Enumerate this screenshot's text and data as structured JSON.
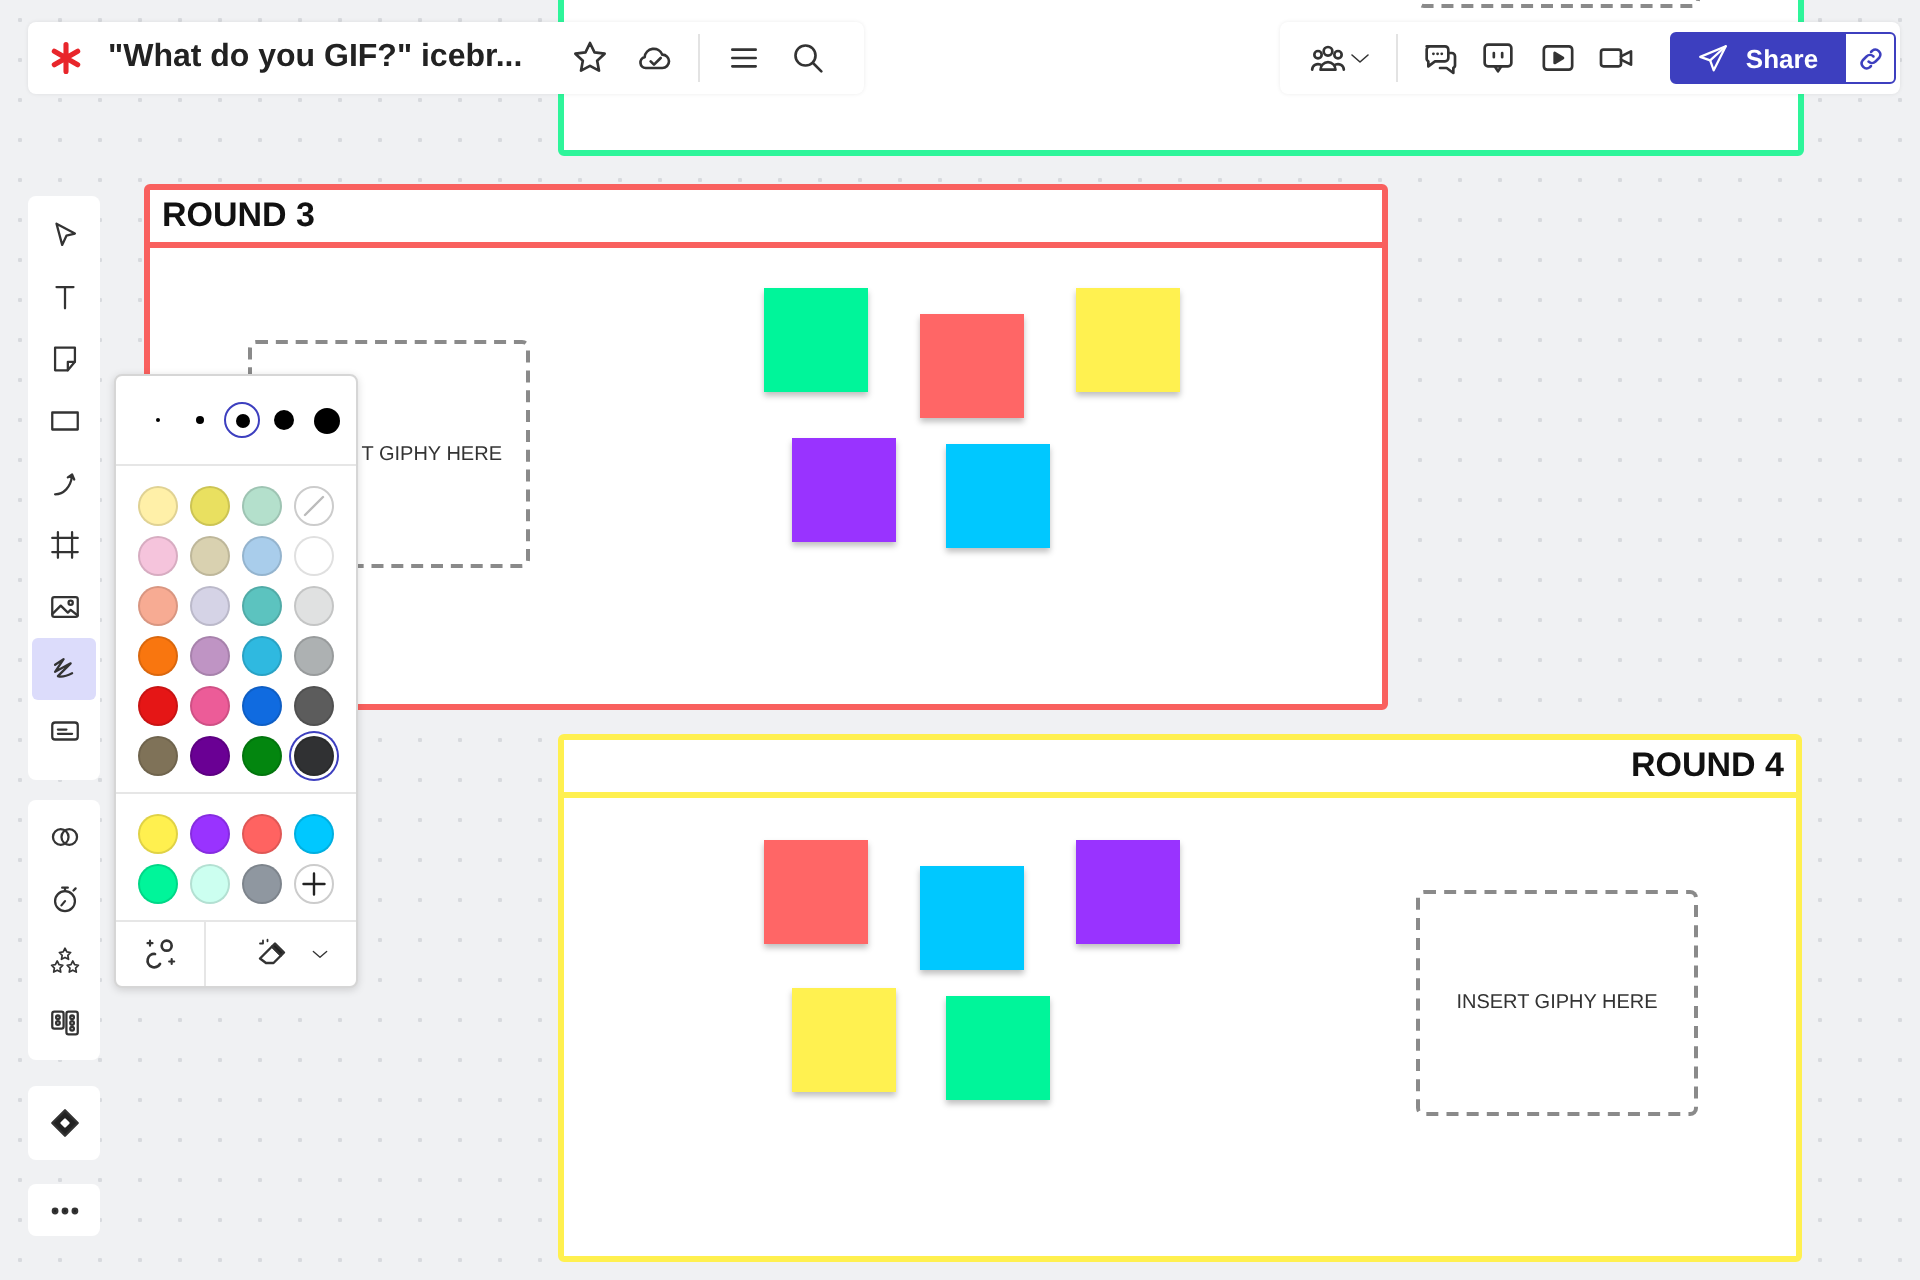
{
  "header": {
    "board_title": "\"What do you GIF?\" icebr...",
    "share_label": "Share"
  },
  "toolbar": {
    "tools": [
      {
        "selected": false
      },
      {
        "selected": false
      },
      {
        "selected": false
      },
      {
        "selected": false
      },
      {
        "selected": false
      },
      {
        "selected": false
      },
      {
        "selected": false
      },
      {
        "selected": true
      },
      {
        "selected": false
      }
    ],
    "extras": [
      {
        "selected": false
      },
      {
        "selected": false
      },
      {
        "selected": false
      },
      {
        "selected": false
      }
    ]
  },
  "pen_panel": {
    "sizes": [
      {
        "selected": false
      },
      {
        "selected": false
      },
      {
        "selected": true
      },
      {
        "selected": false
      },
      {
        "selected": false
      }
    ],
    "colors": [
      {
        "kind": "swatch",
        "color": "#fff0a8",
        "selected": false
      },
      {
        "kind": "swatch",
        "color": "#e9e060",
        "selected": false
      },
      {
        "kind": "swatch",
        "color": "#b4e0cc",
        "selected": false
      },
      {
        "kind": "none",
        "selected": false
      },
      {
        "kind": "swatch",
        "color": "#f5c4dc",
        "selected": false
      },
      {
        "kind": "swatch",
        "color": "#d9d1b0",
        "selected": false
      },
      {
        "kind": "swatch",
        "color": "#a9cdeb",
        "selected": false
      },
      {
        "kind": "swatch",
        "color": "#ffffff",
        "selected": false
      },
      {
        "kind": "swatch",
        "color": "#f7ab93",
        "selected": false
      },
      {
        "kind": "swatch",
        "color": "#d5d3e6",
        "selected": false
      },
      {
        "kind": "swatch",
        "color": "#5cc3bf",
        "selected": false
      },
      {
        "kind": "swatch",
        "color": "#e0e1e1",
        "selected": false
      },
      {
        "kind": "swatch",
        "color": "#f9760f",
        "selected": false
      },
      {
        "kind": "swatch",
        "color": "#bf94c4",
        "selected": false
      },
      {
        "kind": "swatch",
        "color": "#2fb9e0",
        "selected": false
      },
      {
        "kind": "swatch",
        "color": "#adb1b2",
        "selected": false
      },
      {
        "kind": "swatch",
        "color": "#e51616",
        "selected": false
      },
      {
        "kind": "swatch",
        "color": "#ec5c98",
        "selected": false
      },
      {
        "kind": "swatch",
        "color": "#106be0",
        "selected": false
      },
      {
        "kind": "swatch",
        "color": "#5c5c5c",
        "selected": false
      },
      {
        "kind": "swatch",
        "color": "#7f7258",
        "selected": false
      },
      {
        "kind": "swatch",
        "color": "#6a0094",
        "selected": false
      },
      {
        "kind": "swatch",
        "color": "#03860f",
        "selected": false
      },
      {
        "kind": "swatch",
        "color": "#303133",
        "selected": true
      }
    ],
    "custom_colors": [
      {
        "color": "#fff04f",
        "selected": false
      },
      {
        "color": "#9933ff",
        "selected": false
      },
      {
        "color": "#ff6361",
        "selected": false
      },
      {
        "color": "#00c8ff",
        "selected": false
      },
      {
        "color": "#00f59a",
        "selected": false
      },
      {
        "color": "#ccfff0",
        "selected": false
      },
      {
        "color": "#8f97a0",
        "selected": false
      }
    ]
  },
  "frames": [
    {
      "color": "#2ef59a"
    },
    {
      "title": "ROUND 3",
      "color": "#f9605e",
      "giphy_text": "T GIPHY HERE",
      "notes": [
        {
          "color": "#00f59a"
        },
        {
          "color": "#ff6666"
        },
        {
          "color": "#fff150"
        },
        {
          "color": "#9933ff"
        },
        {
          "color": "#00c8ff"
        }
      ]
    },
    {
      "title": "ROUND 4",
      "color": "#fff04f",
      "giphy_text": "INSERT GIPHY HERE",
      "notes": [
        {
          "color": "#ff6666"
        },
        {
          "color": "#00c8ff"
        },
        {
          "color": "#9933ff"
        },
        {
          "color": "#fff150"
        },
        {
          "color": "#00f59a"
        }
      ]
    }
  ]
}
